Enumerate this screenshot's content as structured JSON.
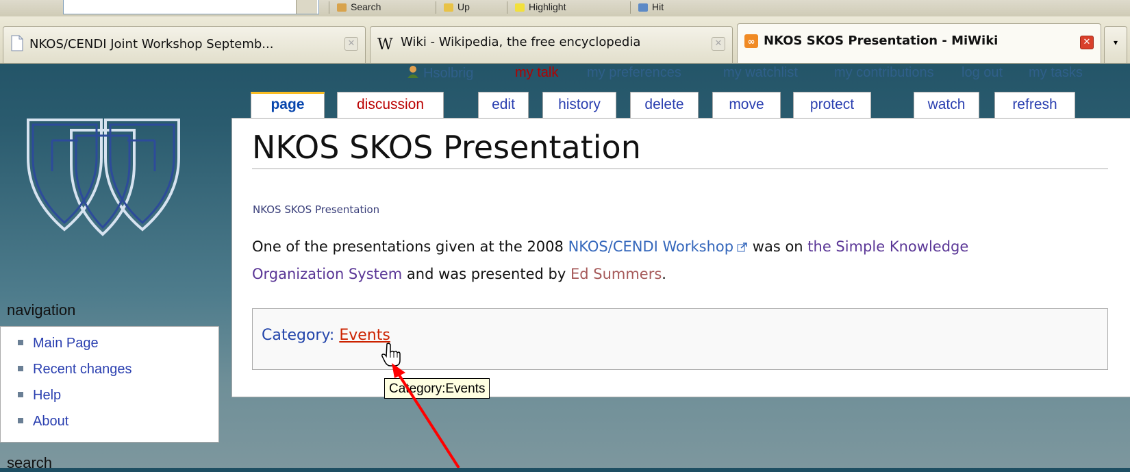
{
  "toolbar": {
    "items": [
      "Search",
      "Up",
      "Highlight",
      "Hit"
    ]
  },
  "browser_tabs": [
    {
      "title": "NKOS/CENDI Joint Workshop Septemb...",
      "active": false
    },
    {
      "title": "Wiki - Wikipedia, the free encyclopedia",
      "active": false
    },
    {
      "title": "NKOS SKOS Presentation - MiWiki",
      "active": true
    }
  ],
  "personal": {
    "user": "Hsolbrig",
    "talk": "my talk",
    "preferences": "my preferences",
    "watchlist": "my watchlist",
    "contributions": "my contributions",
    "logout": "log out",
    "tasks": "my tasks"
  },
  "wiki_tabs": {
    "page": "page",
    "discussion": "discussion",
    "edit": "edit",
    "history": "history",
    "delete": "delete",
    "move": "move",
    "protect": "protect",
    "watch": "watch",
    "refresh": "refresh"
  },
  "article": {
    "title": "NKOS SKOS Presentation",
    "subtitle": "NKOS SKOS Presentation",
    "p_part1": "One of the presentations given at the 2008 ",
    "link_workshop": "NKOS/CENDI Workshop",
    "p_part2": " was on ",
    "link_skos_1": "the Simple",
    "link_skos_2": "Knowledge Organization System",
    "p_part3": " and was presented by ",
    "link_author": "Ed Summers",
    "p_part4": "."
  },
  "categories": {
    "label": "Category",
    "sep": ": ",
    "link": "Events",
    "tooltip": "Category:Events"
  },
  "sidebar": {
    "navigation_title": "navigation",
    "items": [
      {
        "label": "Main Page"
      },
      {
        "label": "Recent changes"
      },
      {
        "label": "Help"
      },
      {
        "label": "About"
      }
    ],
    "search_title": "search"
  },
  "colors": {
    "accent_red": "#ff0000",
    "new_link": "#ba0000",
    "selected_tab_top": "#fabd23"
  }
}
